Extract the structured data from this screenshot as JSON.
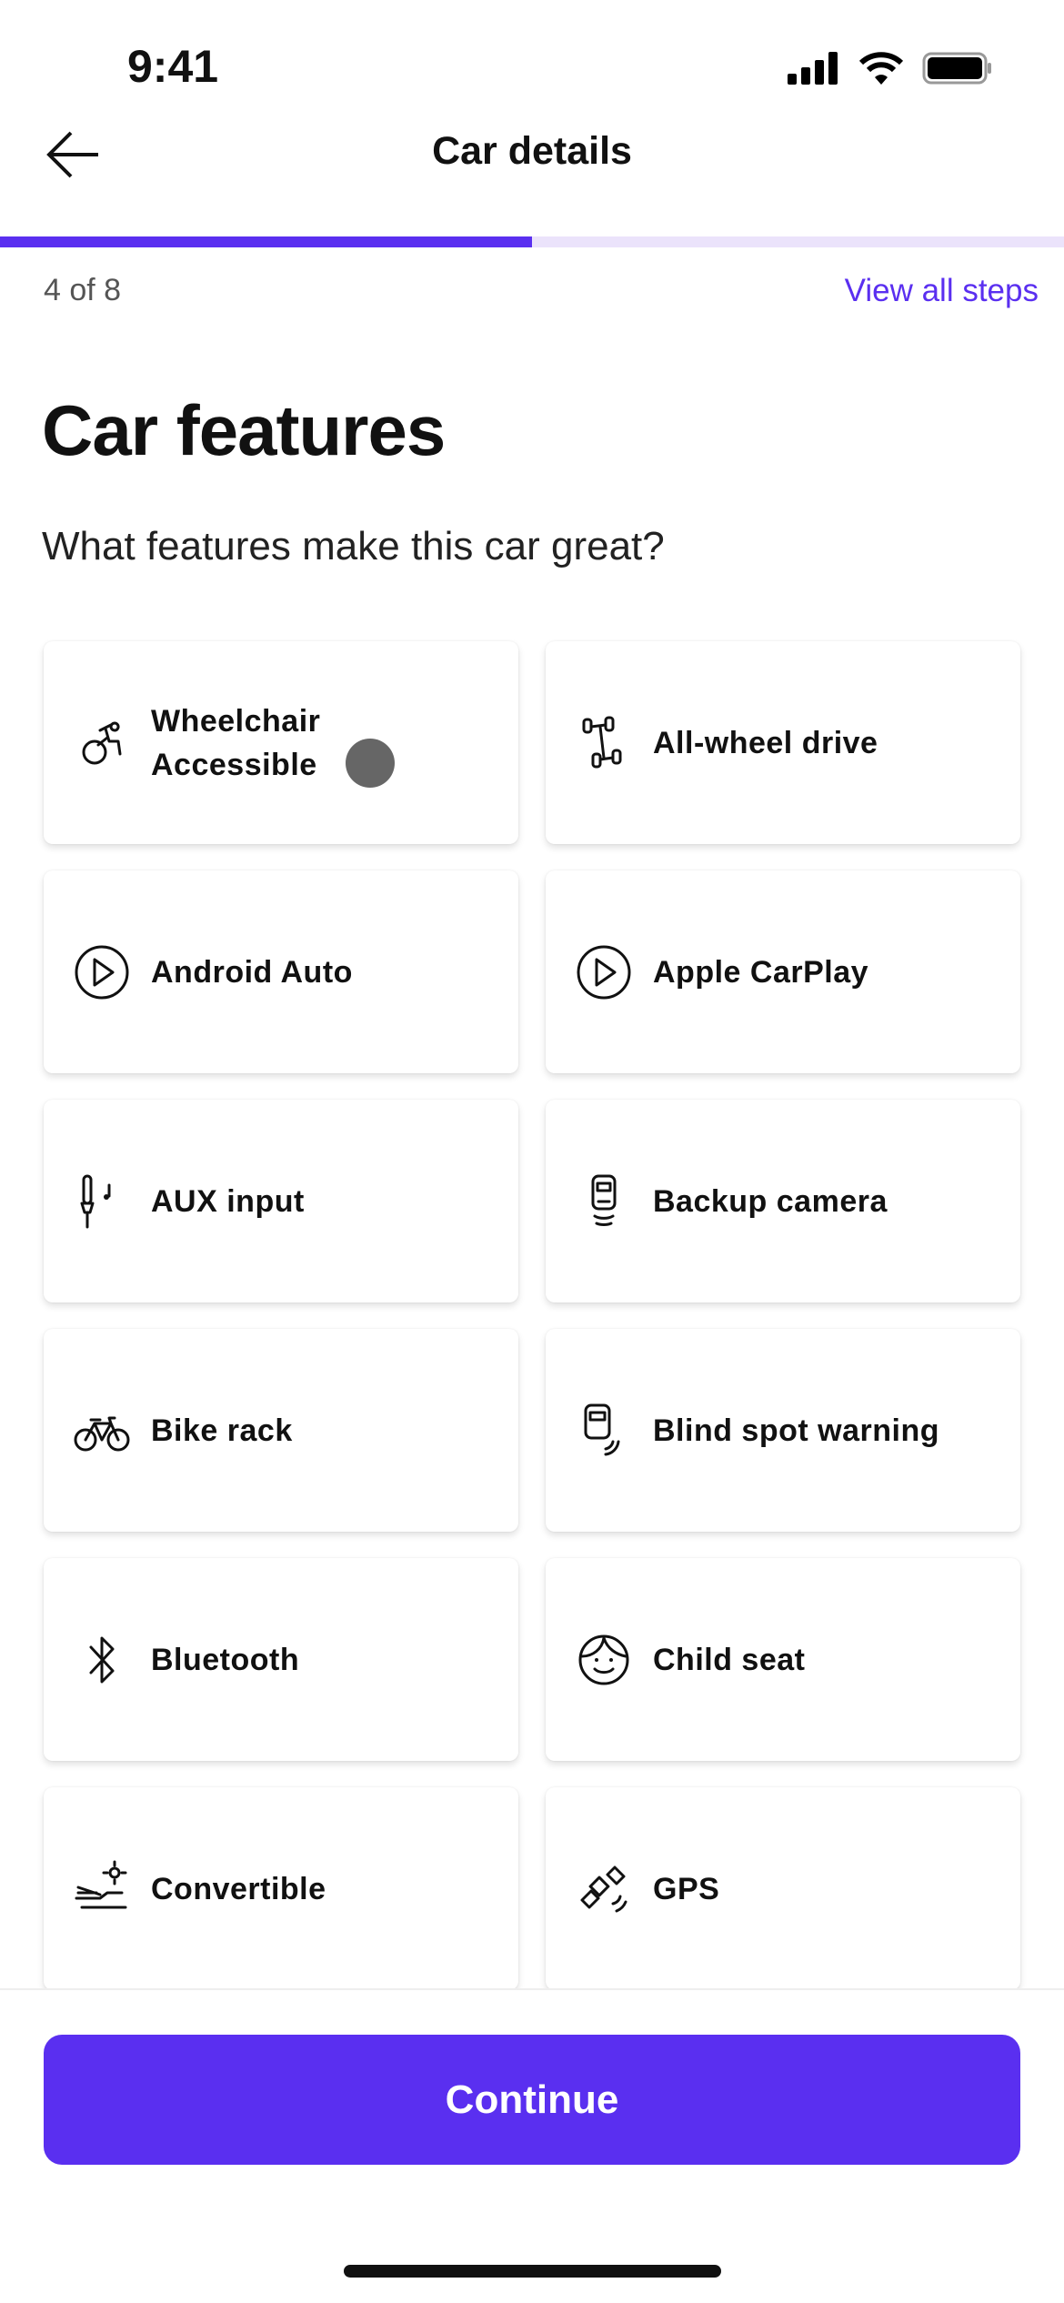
{
  "status_bar": {
    "time": "9:41"
  },
  "nav": {
    "title": "Car details",
    "back_icon": "arrow-left-icon"
  },
  "progress": {
    "current": 4,
    "total": 8,
    "fraction": 0.5,
    "label": "4 of 8",
    "view_all": "View all steps"
  },
  "page": {
    "title": "Car features",
    "subtitle": "What features make this car great?"
  },
  "features": [
    {
      "label": "Wheelchair\nAccessible",
      "icon": "wheelchair-icon"
    },
    {
      "label": "All-wheel drive",
      "icon": "axle-icon"
    },
    {
      "label": "Android Auto",
      "icon": "play-circle-icon"
    },
    {
      "label": "Apple CarPlay",
      "icon": "play-circle-icon"
    },
    {
      "label": "AUX input",
      "icon": "aux-jack-icon"
    },
    {
      "label": "Backup camera",
      "icon": "backup-camera-icon"
    },
    {
      "label": "Bike rack",
      "icon": "bicycle-icon"
    },
    {
      "label": "Blind spot warning",
      "icon": "blind-spot-icon"
    },
    {
      "label": "Bluetooth",
      "icon": "bluetooth-icon"
    },
    {
      "label": "Child seat",
      "icon": "child-face-icon"
    },
    {
      "label": "Convertible",
      "icon": "convertible-icon"
    },
    {
      "label": "GPS",
      "icon": "satellite-icon"
    }
  ],
  "footer": {
    "continue": "Continue"
  },
  "colors": {
    "accent": "#5a2ff0",
    "progress_track": "#ebe3fb"
  }
}
